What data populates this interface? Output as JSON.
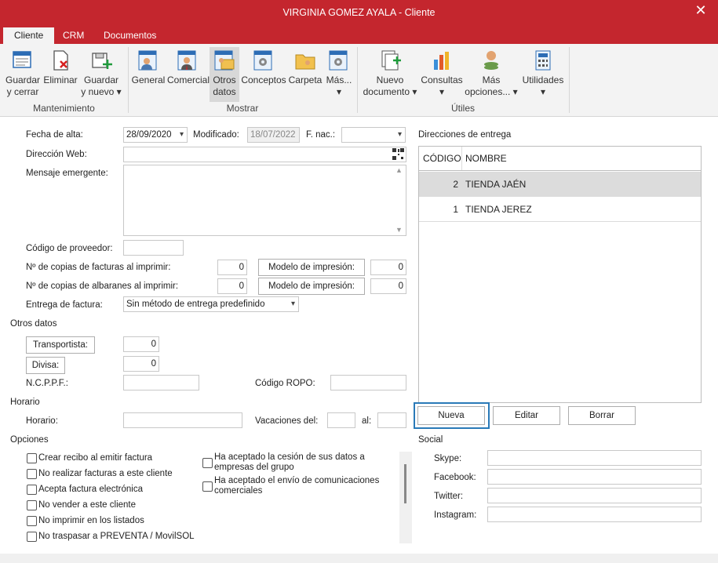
{
  "window": {
    "title": "VIRGINIA GOMEZ AYALA - Cliente",
    "close": "✕"
  },
  "tabs": [
    "Cliente",
    "CRM",
    "Documentos"
  ],
  "ribbon": {
    "mantenimiento": {
      "group": "Mantenimiento",
      "guardar_cerrar": [
        "Guardar",
        "y cerrar"
      ],
      "eliminar": "Eliminar",
      "guardar_nuevo": [
        "Guardar",
        "y nuevo ▾"
      ]
    },
    "mostrar": {
      "group": "Mostrar",
      "general": "General",
      "comercial": "Comercial",
      "otros_datos": [
        "Otros",
        "datos"
      ],
      "conceptos": "Conceptos",
      "carpeta": "Carpeta",
      "mas": "Más...",
      "mas_arrow": "▾"
    },
    "utiles": {
      "group": "Útiles",
      "nuevo_documento": [
        "Nuevo",
        "documento ▾"
      ],
      "consultas": "Consultas",
      "consultas_arrow": "▾",
      "mas_opciones": [
        "Más",
        "opciones... ▾"
      ],
      "utilidades": "Utilidades",
      "utilidades_arrow": "▾"
    }
  },
  "form": {
    "fecha_alta_label": "Fecha de alta:",
    "fecha_alta": "28/09/2020",
    "modificado_label": "Modificado:",
    "modificado": "18/07/2022",
    "fnac_label": "F. nac.:",
    "fnac": "",
    "web_label": "Dirección Web:",
    "web": "",
    "mensaje_label": "Mensaje emergente:",
    "mensaje": "",
    "proveedor_label": "Código de proveedor:",
    "proveedor": "",
    "copias_fact_label": "Nº de copias de facturas al imprimir:",
    "copias_fact": "0",
    "modelo_label": "Modelo de impresión:",
    "modelo_fact": "0",
    "copias_alb_label": "Nº de copias de albaranes al imprimir:",
    "copias_alb": "0",
    "modelo_alb": "0",
    "entrega_label": "Entrega de factura:",
    "entrega": "Sin método de entrega predefinido"
  },
  "otros": {
    "title": "Otros datos",
    "transportista": "Transportista:",
    "transportista_val": "0",
    "divisa": "Divisa:",
    "divisa_val": "0",
    "ncppf_label": "N.C.P.P.F.:",
    "ncppf": "",
    "ropo_label": "Código ROPO:",
    "ropo": ""
  },
  "horario": {
    "title": "Horario",
    "horario_label": "Horario:",
    "vacaciones_label": "Vacaciones del:",
    "al_label": "al:"
  },
  "opciones": {
    "title": "Opciones",
    "left": [
      "Crear recibo al emitir factura",
      "No realizar facturas a este cliente",
      "Acepta factura electrónica",
      "No vender a este cliente",
      "No imprimir en los listados",
      "No traspasar a PREVENTA / MovilSOL"
    ],
    "right": [
      [
        "Ha aceptado la cesión de sus datos a",
        "empresas del grupo"
      ],
      [
        "Ha aceptado el envío de comunicaciones",
        "comerciales"
      ]
    ]
  },
  "direcciones": {
    "title": "Direcciones de entrega",
    "col_codigo": "CÓDIGO",
    "col_nombre": "NOMBRE",
    "rows": [
      {
        "codigo": "2",
        "nombre": "TIENDA JAÉN"
      },
      {
        "codigo": "1",
        "nombre": "TIENDA JEREZ"
      }
    ],
    "nueva": "Nueva",
    "editar": "Editar",
    "borrar": "Borrar"
  },
  "social": {
    "title": "Social",
    "skype": "Skype:",
    "facebook": "Facebook:",
    "twitter": "Twitter:",
    "instagram": "Instagram:"
  },
  "colors": {
    "accent": "#c4262e",
    "focus": "#2a7ab8"
  }
}
